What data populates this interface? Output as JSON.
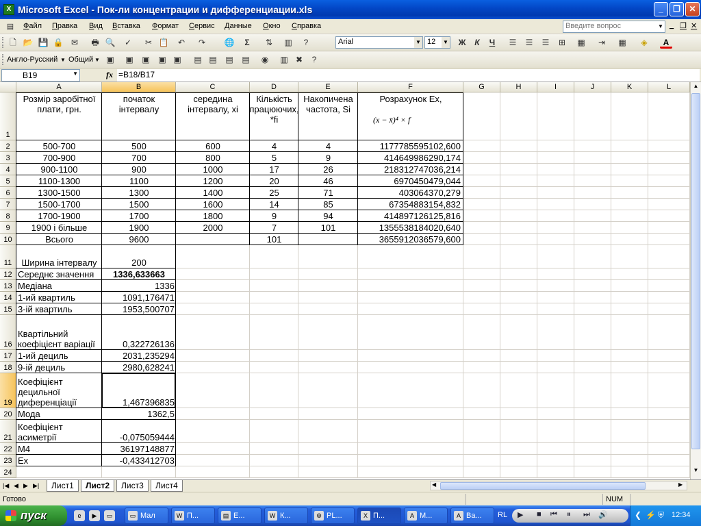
{
  "window": {
    "title": "Microsoft Excel - Пок-ли концентрации и дифференциации.xls",
    "app_icon": "excel-icon"
  },
  "menu": {
    "items": [
      "Файл",
      "Правка",
      "Вид",
      "Вставка",
      "Формат",
      "Сервис",
      "Данные",
      "Окно",
      "Справка"
    ],
    "ask_placeholder": "Введите вопрос"
  },
  "format_toolbar": {
    "font": "Arial",
    "size": "12",
    "bold": "Ж",
    "italic": "К",
    "underline": "Ч",
    "font_color_letter": "A"
  },
  "toolbar3": {
    "language": "Англо-Русский",
    "general": "Общий"
  },
  "formula_bar": {
    "cell_ref": "B19",
    "fx": "fx",
    "formula": "=B18/B17"
  },
  "columns": [
    "A",
    "B",
    "C",
    "D",
    "E",
    "F",
    "G",
    "H",
    "I",
    "J",
    "K",
    "L"
  ],
  "rows": [
    "1",
    "2",
    "3",
    "4",
    "5",
    "6",
    "7",
    "8",
    "9",
    "10",
    "11",
    "12",
    "13",
    "14",
    "15",
    "16",
    "17",
    "18",
    "19",
    "20",
    "21",
    "22",
    "23",
    "24"
  ],
  "header": {
    "a": "Розмір заробітної плати, грн.",
    "b": "початок інтервалу",
    "c": "середина інтервалу, хі",
    "d": "Кількість працюючих, *fi",
    "e": "Накопичена частота, Si",
    "f": "Розрахунок Ех,",
    "f_formula": "(x − x̄)⁴ × f"
  },
  "table": [
    [
      "500-700",
      "500",
      "600",
      "4",
      "4",
      "1177785595102,600"
    ],
    [
      "700-900",
      "700",
      "800",
      "5",
      "9",
      "414649986290,174"
    ],
    [
      "900-1100",
      "900",
      "1000",
      "17",
      "26",
      "218312747036,214"
    ],
    [
      "1100-1300",
      "1100",
      "1200",
      "20",
      "46",
      "6970450479,044"
    ],
    [
      "1300-1500",
      "1300",
      "1400",
      "25",
      "71",
      "403064370,279"
    ],
    [
      "1500-1700",
      "1500",
      "1600",
      "14",
      "85",
      "67354883154,832"
    ],
    [
      "1700-1900",
      "1700",
      "1800",
      "9",
      "94",
      "414897126125,816"
    ],
    [
      "1900 і більше",
      "1900",
      "2000",
      "7",
      "101",
      "1355538184020,640"
    ]
  ],
  "total": {
    "label": "Всього",
    "b": "9600",
    "d": "101",
    "f": "3655912036579,600"
  },
  "stats": {
    "width_label": "Ширина інтервалу",
    "width_value": "200",
    "mean_label": "Середнє значення",
    "mean_value": "1336,633663",
    "median_label": "Медіана",
    "median_value": "1336",
    "q1_label": "1-ий квартиль",
    "q1_value": "1091,176471",
    "q3_label": "3-ій квартиль",
    "q3_value": "1953,500707",
    "qcv_label": "Квартільний коефіцієнт варіації",
    "qcv_value": "0,322726136",
    "d1_label": "1-ий дециль",
    "d1_value": "2031,235294",
    "d9_label": "9-ій дециль",
    "d9_value": "2980,628241",
    "ddc_label": "Коефіцієнт децильної диференціації",
    "ddc_value": "1,467396835",
    "mode_label": "Мода",
    "mode_value": "1362,5",
    "asym_label": "Коефіцієнт асиметрії",
    "asym_value": "-0,075059444",
    "m4_label": "M4",
    "m4_value": "36197148877",
    "ex_label": "Ex",
    "ex_value": "-0,433412703"
  },
  "sheets": [
    "Лист1",
    "Лист2",
    "Лист3",
    "Лист4"
  ],
  "active_sheet": "Лист2",
  "status": {
    "ready": "Готово",
    "num": "NUM"
  },
  "taskbar": {
    "start": "пуск",
    "items": [
      "Мал",
      "П...",
      "E...",
      "К...",
      "PL...",
      "П...",
      "М...",
      "Ва..."
    ],
    "lang": "RL",
    "clock": "12:34"
  }
}
